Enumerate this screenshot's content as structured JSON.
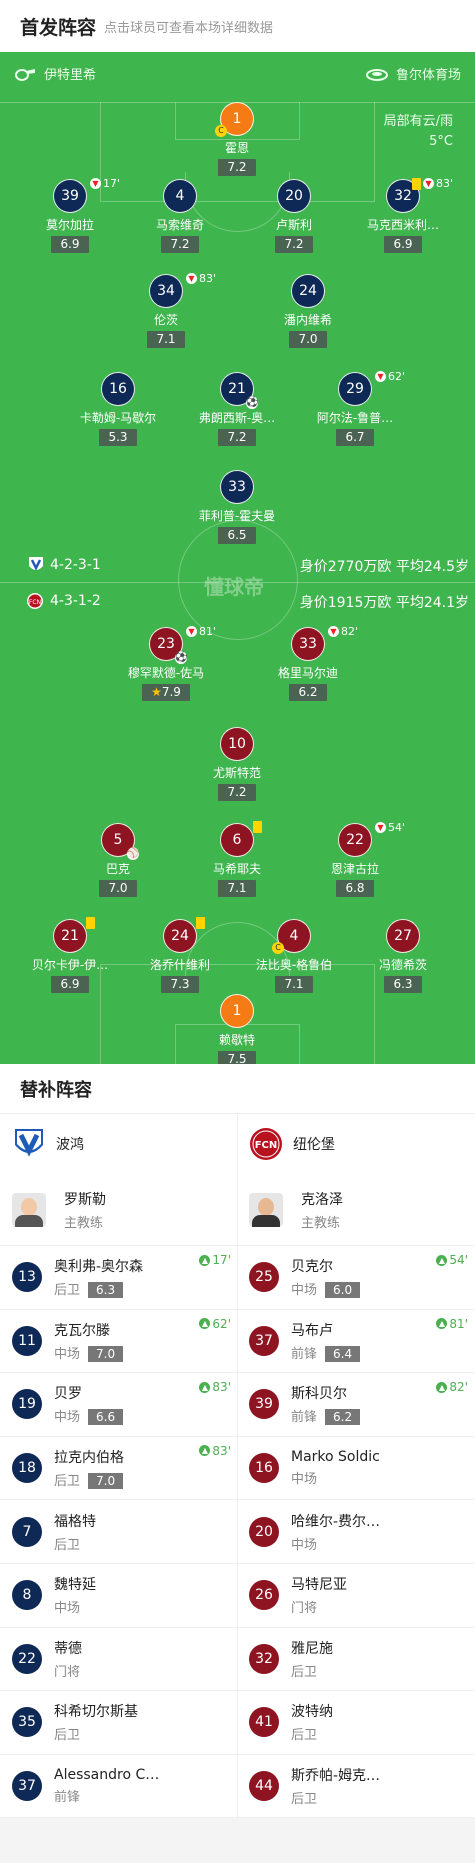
{
  "header": {
    "title": "首发阵容",
    "subtitle": "点击球员可查看本场详细数据"
  },
  "pitch": {
    "referee": "伊特里希",
    "stadium": "鲁尔体育场",
    "weather": "局部有云/雨",
    "temp": "5°C",
    "watermark": "懂球帝",
    "home": {
      "formation": "4-2-3-1",
      "info": "身价2770万欧 平均24.5岁"
    },
    "away": {
      "formation": "4-3-1-2",
      "info": "身价1915万欧 平均24.1岁"
    },
    "colors": {
      "home": "#0f2956",
      "away": "#8e1421",
      "gk": "#f57c14",
      "pitch": "#3fb54e"
    }
  },
  "home_players": [
    {
      "num": "1",
      "name": "霍恩",
      "rating": "7.2",
      "captain": "C"
    },
    {
      "num": "39",
      "name": "莫尔加拉",
      "rating": "6.9",
      "time": "17'"
    },
    {
      "num": "4",
      "name": "马索维奇",
      "rating": "7.2"
    },
    {
      "num": "20",
      "name": "卢斯利",
      "rating": "7.2"
    },
    {
      "num": "32",
      "name": "马克西米利…",
      "rating": "6.9",
      "time": "83'"
    },
    {
      "num": "34",
      "name": "伦茨",
      "rating": "7.1",
      "time": "83'"
    },
    {
      "num": "24",
      "name": "潘内维希",
      "rating": "7.0"
    },
    {
      "num": "16",
      "name": "卡勒姆-马歇尔",
      "rating": "5.3"
    },
    {
      "num": "21",
      "name": "弗朗西斯-奥…",
      "rating": "7.2"
    },
    {
      "num": "29",
      "name": "阿尔法-鲁普…",
      "rating": "6.7",
      "time": "62'"
    },
    {
      "num": "33",
      "name": "菲利普-霍夫曼",
      "rating": "6.5"
    }
  ],
  "away_players": [
    {
      "num": "23",
      "name": "穆罕默德-佐马",
      "rating": "7.9",
      "time": "81'"
    },
    {
      "num": "33",
      "name": "格里马尔迪",
      "rating": "6.2",
      "time": "82'"
    },
    {
      "num": "10",
      "name": "尤斯特范",
      "rating": "7.2"
    },
    {
      "num": "5",
      "name": "巴克",
      "rating": "7.0"
    },
    {
      "num": "6",
      "name": "马希耶夫",
      "rating": "7.1"
    },
    {
      "num": "22",
      "name": "恩津古拉",
      "rating": "6.8",
      "time": "54'"
    },
    {
      "num": "21",
      "name": "贝尔卡伊-伊…",
      "rating": "6.9"
    },
    {
      "num": "24",
      "name": "洛乔什维利",
      "rating": "7.3"
    },
    {
      "num": "4",
      "name": "法比奥-格鲁伯",
      "rating": "7.1",
      "captain": "C"
    },
    {
      "num": "27",
      "name": "冯德希茨",
      "rating": "6.3"
    },
    {
      "num": "1",
      "name": "赖歇特",
      "rating": "7.5"
    }
  ],
  "subs": {
    "title": "替补阵容",
    "home": {
      "team": "波鸿",
      "coach": "罗斯勒",
      "coach_role": "主教练",
      "players": [
        {
          "num": "13",
          "name": "奥利弗-奥尔森",
          "pos": "后卫",
          "rating": "6.3",
          "time": "17'"
        },
        {
          "num": "11",
          "name": "克瓦尔滕",
          "pos": "中场",
          "rating": "7.0",
          "time": "62'"
        },
        {
          "num": "19",
          "name": "贝罗",
          "pos": "中场",
          "rating": "6.6",
          "time": "83'"
        },
        {
          "num": "18",
          "name": "拉克内伯格",
          "pos": "后卫",
          "rating": "7.0",
          "time": "83'"
        },
        {
          "num": "7",
          "name": "福格特",
          "pos": "后卫"
        },
        {
          "num": "8",
          "name": "魏特延",
          "pos": "中场"
        },
        {
          "num": "22",
          "name": "蒂德",
          "pos": "门将"
        },
        {
          "num": "35",
          "name": "科希切尔斯基",
          "pos": "后卫"
        },
        {
          "num": "37",
          "name": "Alessandro C…",
          "pos": "前锋"
        }
      ]
    },
    "away": {
      "team": "纽伦堡",
      "coach": "克洛泽",
      "coach_role": "主教练",
      "players": [
        {
          "num": "25",
          "name": "贝克尔",
          "pos": "中场",
          "rating": "6.0",
          "time": "54'"
        },
        {
          "num": "37",
          "name": "马布卢",
          "pos": "前锋",
          "rating": "6.4",
          "time": "81'"
        },
        {
          "num": "39",
          "name": "斯科贝尔",
          "pos": "前锋",
          "rating": "6.2",
          "time": "82'"
        },
        {
          "num": "16",
          "name": "Marko Soldic",
          "pos": "中场"
        },
        {
          "num": "20",
          "name": "哈维尔-费尔…",
          "pos": "中场"
        },
        {
          "num": "26",
          "name": "马特尼亚",
          "pos": "门将"
        },
        {
          "num": "32",
          "name": "雅尼施",
          "pos": "后卫"
        },
        {
          "num": "41",
          "name": "波特纳",
          "pos": "后卫"
        },
        {
          "num": "44",
          "name": "斯乔帕-姆克…",
          "pos": "后卫"
        }
      ]
    }
  }
}
